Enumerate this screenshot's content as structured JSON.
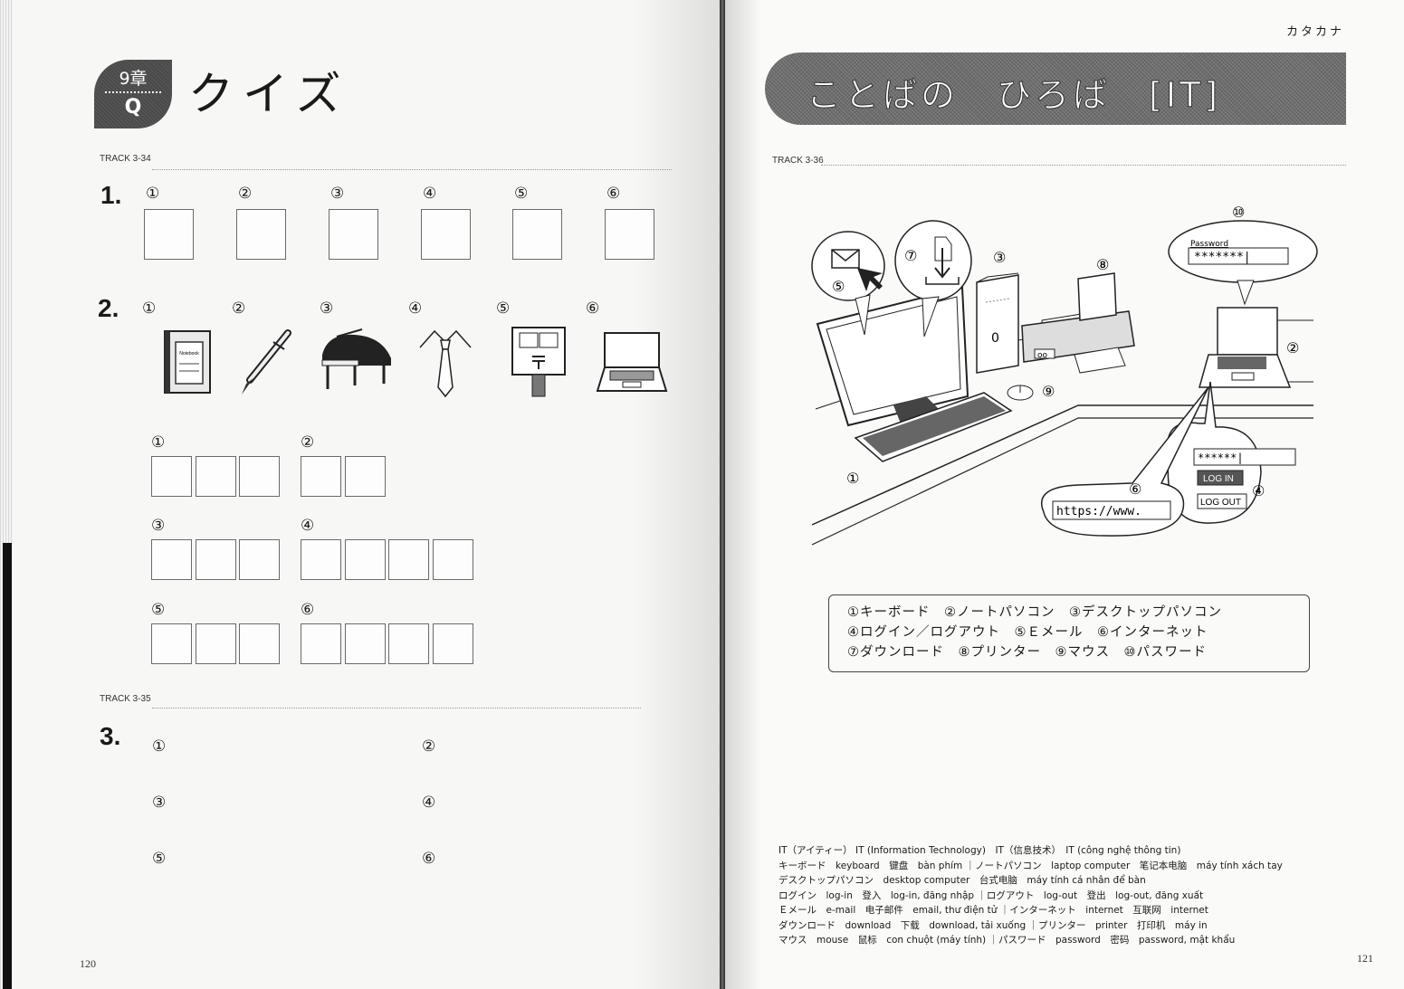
{
  "left_page": {
    "chapter_badge": {
      "chapter": "9章",
      "quiz_mark": "Q"
    },
    "title": "クイズ",
    "track_1": "TRACK 3-34",
    "track_2": "TRACK 3-35",
    "page_number": "120",
    "q1": {
      "number": "1.",
      "labels": [
        "①",
        "②",
        "③",
        "④",
        "⑤",
        "⑥"
      ]
    },
    "q2": {
      "number": "2.",
      "labels": [
        "①",
        "②",
        "③",
        "④",
        "⑤",
        "⑥"
      ],
      "pictures": [
        "notebook-icon",
        "pen-icon",
        "piano-icon",
        "necktie-icon",
        "postbox-icon",
        "laptop-icon"
      ],
      "notebook_text": "Notebook",
      "answer_groups": [
        {
          "label": "①",
          "boxes": 3
        },
        {
          "label": "②",
          "boxes": 2
        },
        {
          "label": "③",
          "boxes": 3
        },
        {
          "label": "④",
          "boxes": 4
        },
        {
          "label": "⑤",
          "boxes": 3
        },
        {
          "label": "⑥",
          "boxes": 4
        }
      ]
    },
    "q3": {
      "number": "3.",
      "labels": [
        "①",
        "②",
        "③",
        "④",
        "⑤",
        "⑥"
      ]
    }
  },
  "right_page": {
    "header_label": "カタカナ",
    "banner_title": "ことばの　ひろば　[IT]",
    "track": "TRACK 3-36",
    "page_number": "121",
    "illustration": {
      "markers": [
        "①",
        "②",
        "③",
        "④",
        "⑤",
        "⑥",
        "⑦",
        "⑧",
        "⑨",
        "⑩"
      ],
      "password_label": "Password",
      "password_value": "*******|",
      "login_password": "******|",
      "login_button": "LOG IN",
      "logout_button": "LOG OUT",
      "url": "https://www.",
      "monitor_zero": "0",
      "printer_oo": "oo"
    },
    "legend": [
      "①キーボード　②ノートパソコン　③デスクトップパソコン",
      "④ログイン／ログアウト　⑤Ｅメール　⑥インターネット",
      "⑦ダウンロード　⑧プリンター　⑨マウス　⑩パスワード"
    ],
    "vocabulary": [
      "IT（アイティー） IT (Information Technology)　IT（信息技术）　IT (công nghệ thông tin)",
      "キーボード　keyboard　键盘　bàn phím ｜ノートパソコン　laptop computer　笔记本电脑　máy tính xách tay",
      "デスクトップパソコン　desktop computer　台式电脑　máy tính cá nhân để bàn",
      "ログイン　log-in　登入　log-in, đăng nhập ｜ログアウト　log-out　登出　log-out, đăng xuất",
      "Ｅメール　e-mail　电子邮件　email, thư điện tử ｜インターネット　internet　互联网　internet",
      "ダウンロード　download　下载　download, tải xuống ｜プリンター　printer　打印机　máy in",
      "マウス　mouse　鼠标　con chuột (máy tính) ｜パスワード　password　密码　password, mật khẩu"
    ]
  }
}
